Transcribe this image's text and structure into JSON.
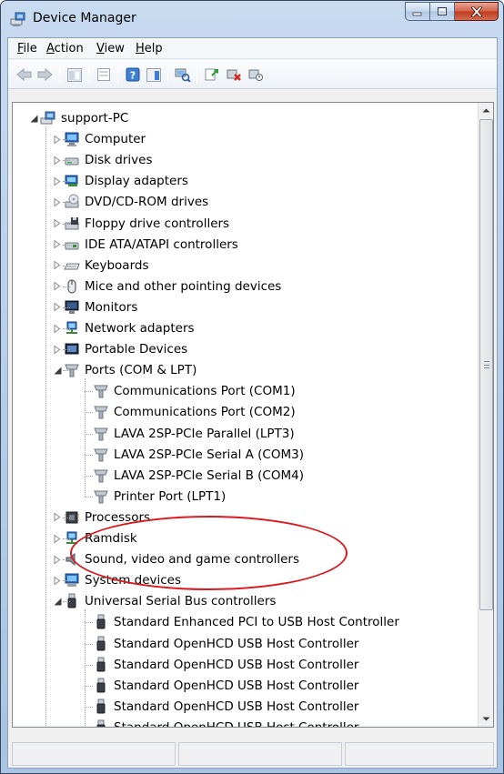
{
  "window": {
    "title": "Device Manager"
  },
  "menu": [
    {
      "key": "file",
      "accel": "F",
      "rest": "ile"
    },
    {
      "key": "action",
      "accel": "A",
      "rest": "ction"
    },
    {
      "key": "view",
      "accel": "V",
      "rest": "iew"
    },
    {
      "key": "help",
      "accel": "H",
      "rest": "elp"
    }
  ],
  "toolbar": [
    "back-icon",
    "forward-icon",
    "show-hide-console-tree-icon",
    "properties-icon",
    "help-icon",
    "action-pane-icon",
    "scan-hardware-changes-icon",
    "update-driver-icon",
    "uninstall-icon",
    "disable-icon"
  ],
  "tree": {
    "root": "support-PC",
    "categories": [
      {
        "key": "computer",
        "label": "Computer",
        "icon": "computer-icon",
        "expanded": false
      },
      {
        "key": "disk",
        "label": "Disk drives",
        "icon": "disk-drive-icon",
        "expanded": false
      },
      {
        "key": "display",
        "label": "Display adapters",
        "icon": "display-adapter-icon",
        "expanded": false
      },
      {
        "key": "dvd",
        "label": "DVD/CD-ROM drives",
        "icon": "dvd-drive-icon",
        "expanded": false
      },
      {
        "key": "floppy",
        "label": "Floppy drive controllers",
        "icon": "floppy-controller-icon",
        "expanded": false
      },
      {
        "key": "ide",
        "label": "IDE ATA/ATAPI controllers",
        "icon": "ide-controller-icon",
        "expanded": false
      },
      {
        "key": "keyboards",
        "label": "Keyboards",
        "icon": "keyboard-icon",
        "expanded": false
      },
      {
        "key": "mice",
        "label": "Mice and other pointing devices",
        "icon": "mouse-icon",
        "expanded": false
      },
      {
        "key": "monitors",
        "label": "Monitors",
        "icon": "monitor-icon",
        "expanded": false
      },
      {
        "key": "network",
        "label": "Network adapters",
        "icon": "network-adapter-icon",
        "expanded": false
      },
      {
        "key": "portable",
        "label": "Portable Devices",
        "icon": "portable-device-icon",
        "expanded": false
      },
      {
        "key": "ports",
        "label": "Ports (COM & LPT)",
        "icon": "port-icon",
        "expanded": true,
        "children": [
          "Communications Port (COM1)",
          "Communications Port (COM2)",
          "LAVA 2SP-PCIe Parallel (LPT3)",
          "LAVA 2SP-PCIe Serial A (COM3)",
          "LAVA 2SP-PCIe Serial B (COM4)",
          "Printer Port (LPT1)"
        ]
      },
      {
        "key": "processors",
        "label": "Processors",
        "icon": "processor-icon",
        "expanded": false
      },
      {
        "key": "ramdisk",
        "label": "Ramdisk",
        "icon": "ramdisk-icon",
        "expanded": false
      },
      {
        "key": "sound",
        "label": "Sound, video and game controllers",
        "icon": "speaker-icon",
        "expanded": false
      },
      {
        "key": "system",
        "label": "System devices",
        "icon": "system-device-icon",
        "expanded": false
      },
      {
        "key": "usb",
        "label": "Universal Serial Bus controllers",
        "icon": "usb-icon",
        "expanded": true,
        "children": [
          "Standard Enhanced PCI to USB Host Controller",
          "Standard OpenHCD USB Host Controller",
          "Standard OpenHCD USB Host Controller",
          "Standard OpenHCD USB Host Controller",
          "Standard OpenHCD USB Host Controller",
          "Standard OpenHCD USB Host Controller"
        ]
      }
    ]
  },
  "colors": {
    "highlight": "#d9191e",
    "titlebar": "#b9cfea",
    "close_button": "#c2391b"
  }
}
